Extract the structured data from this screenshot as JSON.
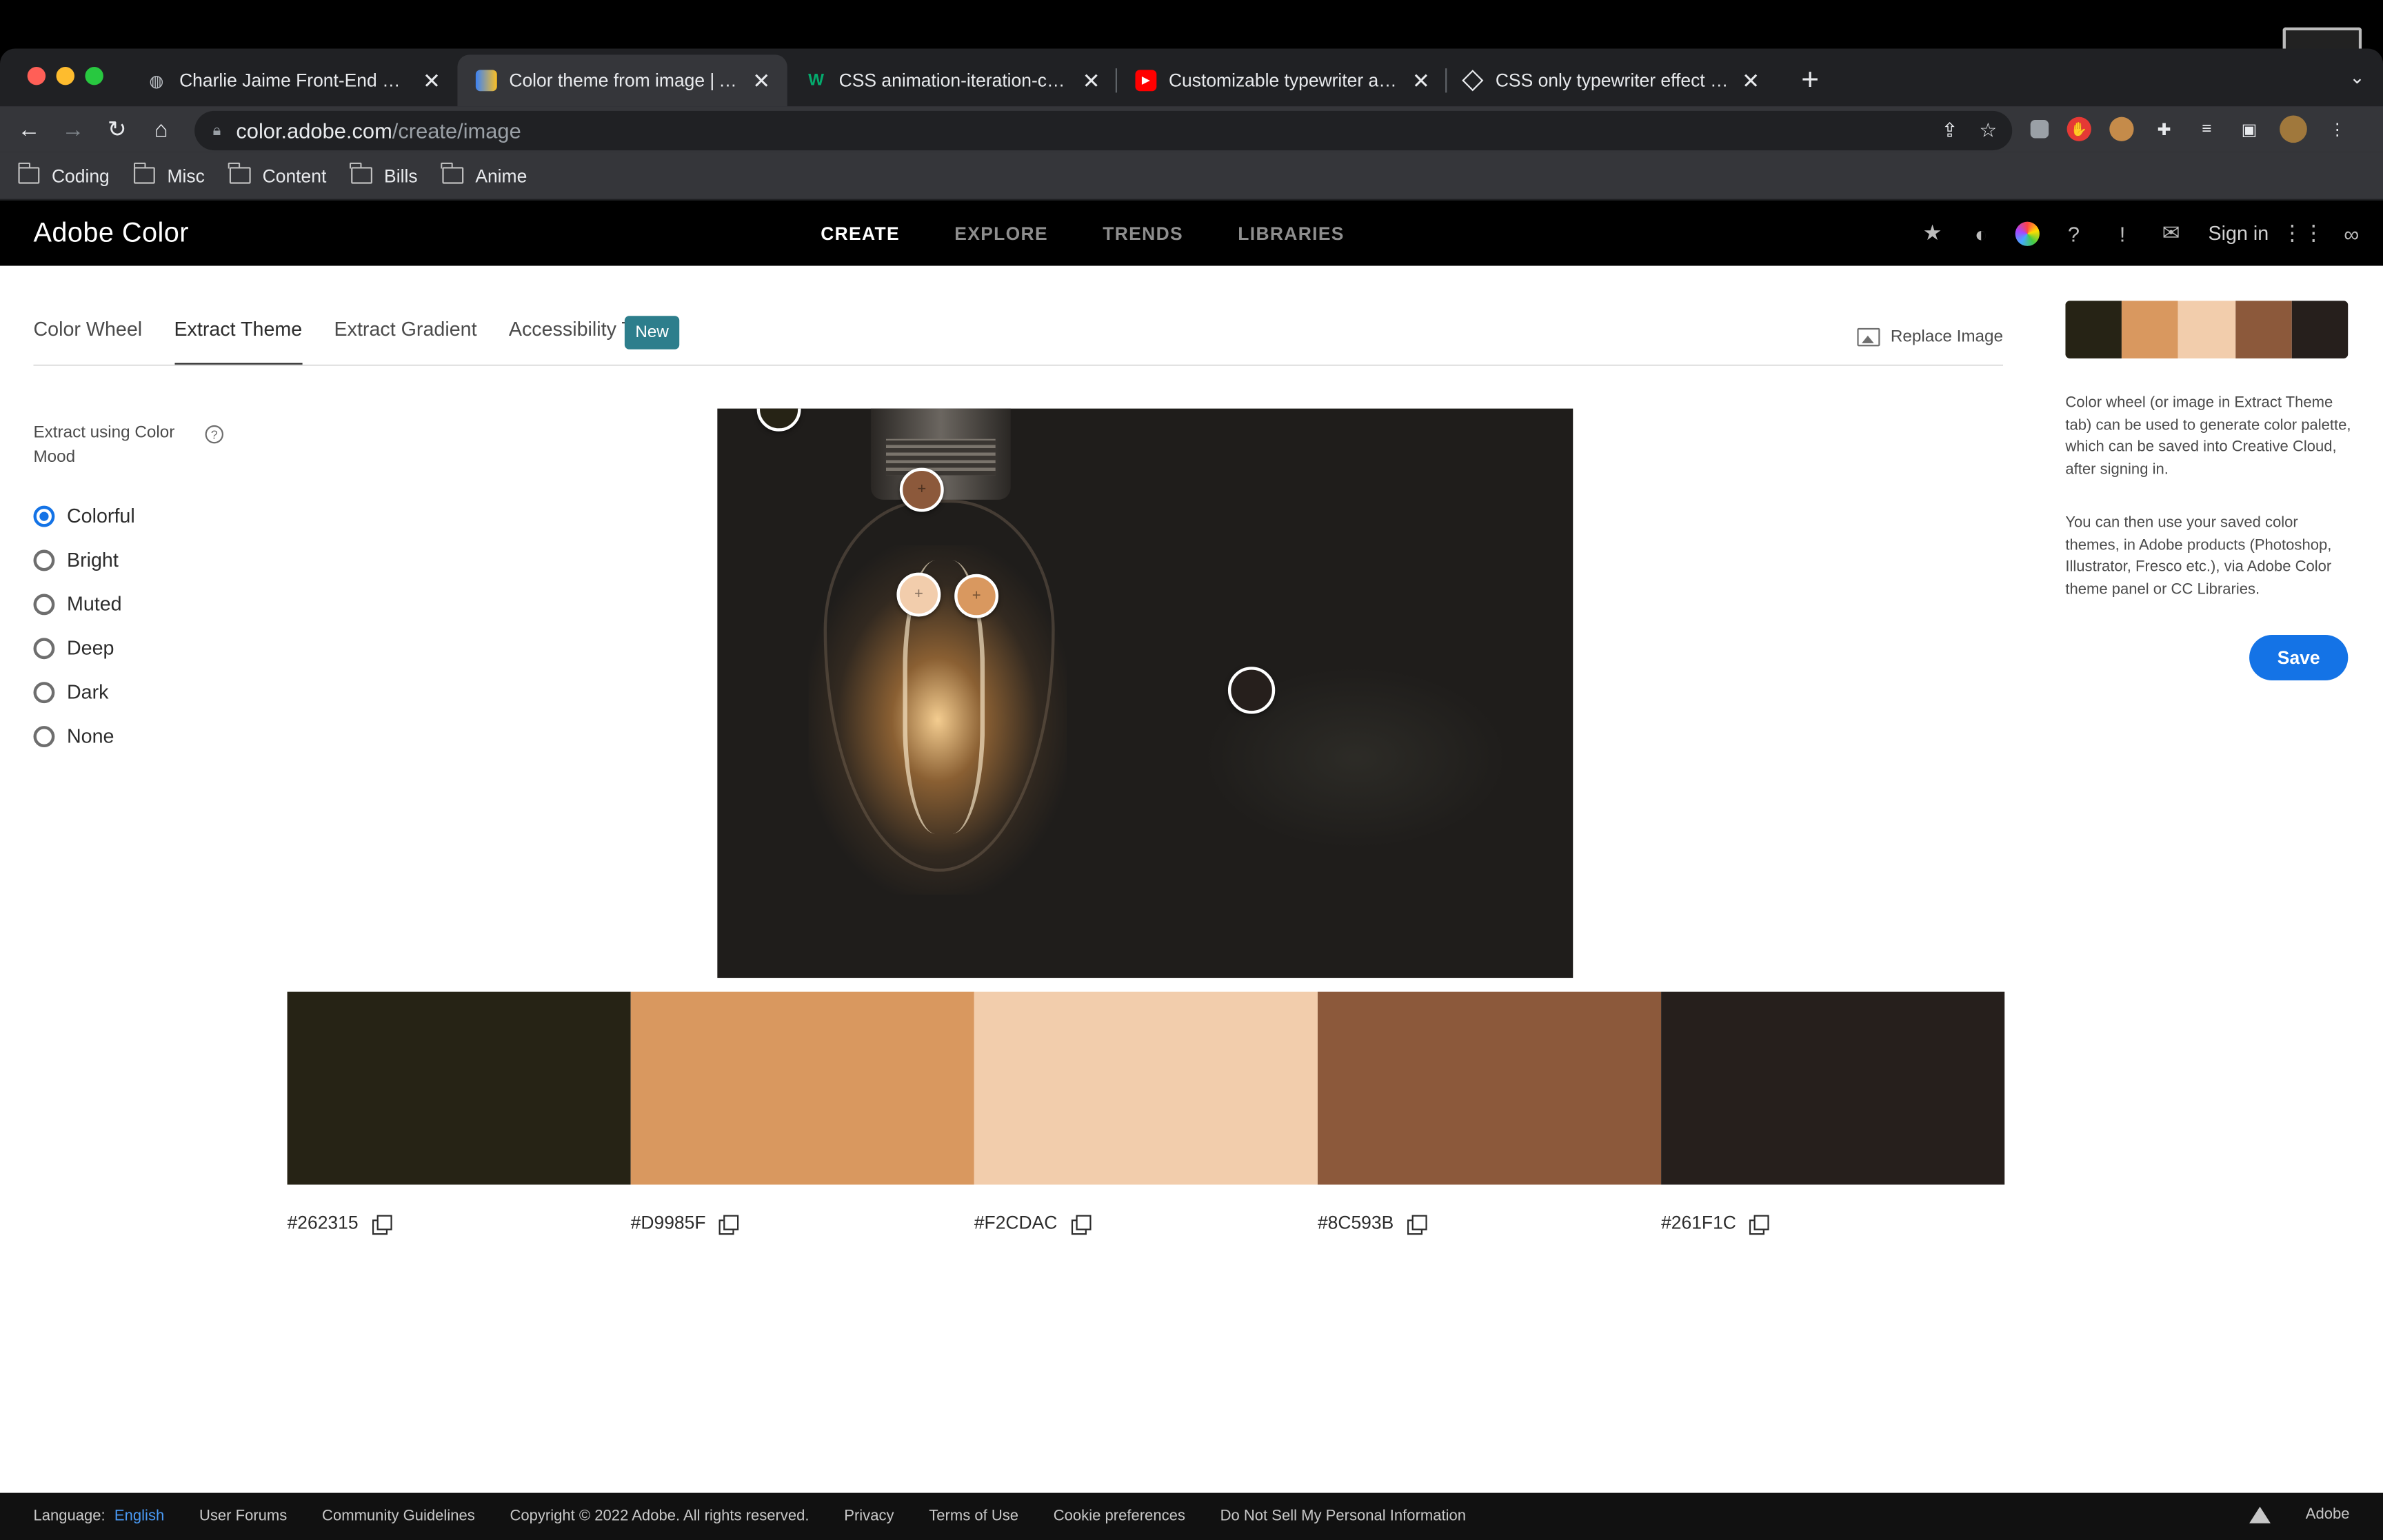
{
  "browser": {
    "tabs": [
      {
        "title": "Charlie Jaime Front-End Developer",
        "favicon": "globe-icon",
        "active": false
      },
      {
        "title": "Color theme from image | Adobe Color",
        "favicon": "adobe-color-icon",
        "active": true
      },
      {
        "title": "CSS animation-iteration-count",
        "favicon": "w3schools-icon",
        "active": false
      },
      {
        "title": "Customizable typewriter animation",
        "favicon": "youtube-icon",
        "active": false
      },
      {
        "title": "CSS only typewriter effect | custom",
        "favicon": "codepen-icon",
        "active": false
      }
    ],
    "url_host": "color.adobe.com",
    "url_path": "/create/image",
    "bookmarks": [
      "Coding",
      "Misc",
      "Content",
      "Bills",
      "Anime"
    ]
  },
  "app": {
    "brand": "Adobe Color",
    "nav": [
      {
        "label": "CREATE",
        "active": true
      },
      {
        "label": "EXPLORE",
        "active": false
      },
      {
        "label": "TRENDS",
        "active": false
      },
      {
        "label": "LIBRARIES",
        "active": false
      }
    ],
    "sign_in": "Sign in"
  },
  "subtabs": [
    "Color Wheel",
    "Extract Theme",
    "Extract Gradient",
    "Accessibility Tools"
  ],
  "active_subtab": "Extract Theme",
  "badge_new": "New",
  "replace_image": "Replace Image",
  "mood": {
    "label": "Extract using Color Mood",
    "options": [
      "Colorful",
      "Bright",
      "Muted",
      "Deep",
      "Dark",
      "None"
    ],
    "selected": "Colorful"
  },
  "palette": [
    {
      "hex": "#262315",
      "color": "#262315"
    },
    {
      "hex": "#D9985F",
      "color": "#D9985F"
    },
    {
      "hex": "#F2CDAC",
      "color": "#F2CDAC"
    },
    {
      "hex": "#8C593B",
      "color": "#8C593B"
    },
    {
      "hex": "#261F1C",
      "color": "#261F1C"
    }
  ],
  "sidebar": {
    "info1": "Color wheel (or image in Extract Theme tab) can be used to generate color palette, which can be saved into Creative Cloud, after signing in.",
    "info2": "You can then use your saved color themes, in Adobe products (Photoshop, Illustrator, Fresco etc.), via Adobe Color theme panel or CC Libraries.",
    "save": "Save"
  },
  "footer": {
    "language_label": "Language:",
    "language_value": "English",
    "links": [
      "User Forums",
      "Community Guidelines",
      "Copyright © 2022 Adobe. All rights reserved.",
      "Privacy",
      "Terms of Use",
      "Cookie preferences",
      "Do Not Sell My Personal Information"
    ],
    "adobe": "Adobe"
  }
}
